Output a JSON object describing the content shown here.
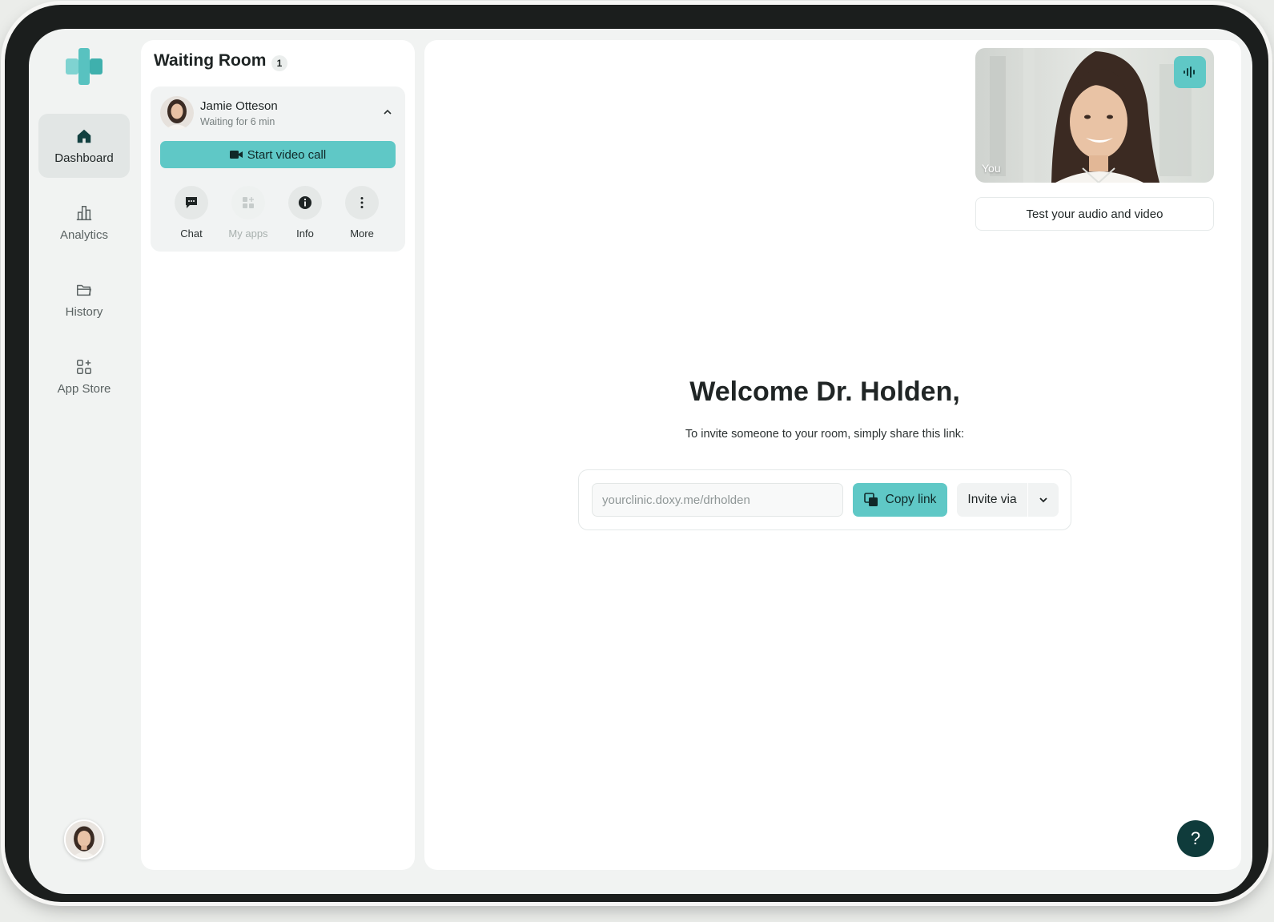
{
  "nav": {
    "items": [
      {
        "label": "Dashboard",
        "icon": "home-icon",
        "active": true
      },
      {
        "label": "Analytics",
        "icon": "bar-chart-icon",
        "active": false
      },
      {
        "label": "History",
        "icon": "folder-icon",
        "active": false
      },
      {
        "label": "App Store",
        "icon": "apps-add-icon",
        "active": false
      }
    ]
  },
  "waiting_room": {
    "title": "Waiting Room",
    "count": "1",
    "patient": {
      "name": "Jamie Otteson",
      "status": "Waiting for 6 min"
    },
    "start_call_label": "Start video call",
    "actions": [
      {
        "label": "Chat",
        "icon": "chat-icon",
        "enabled": true
      },
      {
        "label": "My apps",
        "icon": "apps-icon",
        "enabled": false
      },
      {
        "label": "Info",
        "icon": "info-icon",
        "enabled": true
      },
      {
        "label": "More",
        "icon": "more-vertical-icon",
        "enabled": true
      }
    ]
  },
  "preview": {
    "label": "You",
    "test_label": "Test your audio and video"
  },
  "welcome": {
    "title": "Welcome Dr. Holden,",
    "subtitle": "To invite someone to your room, simply share this link:",
    "link": "yourclinic.doxy.me/drholden",
    "copy_label": "Copy link",
    "invite_label": "Invite via"
  },
  "help": {
    "label": "?"
  },
  "colors": {
    "accent": "#5fc8c6",
    "dark": "#0f3b3b",
    "bezel": "#1b1e1d",
    "background": "#f1f3f2"
  }
}
